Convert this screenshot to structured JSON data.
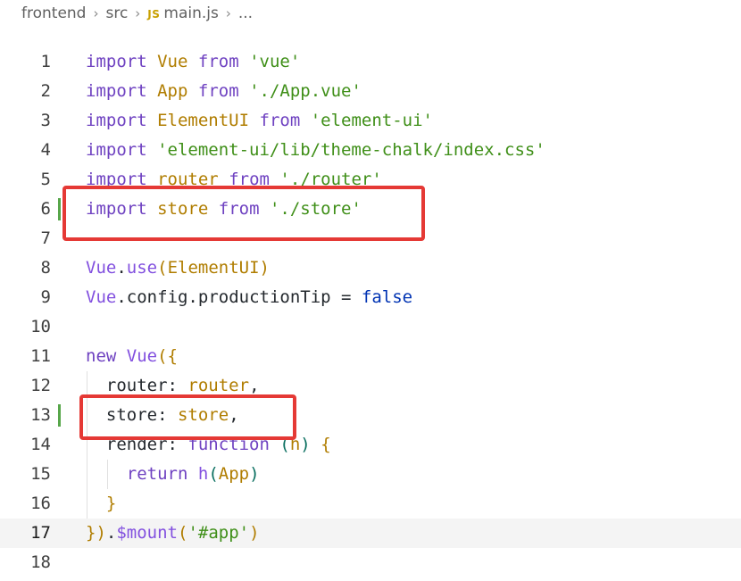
{
  "breadcrumb": {
    "folder1": "frontend",
    "folder2": "src",
    "file_badge": "JS",
    "file": "main.js",
    "more": "..."
  },
  "lines": [
    {
      "n": "1",
      "tokens": [
        [
          "kw",
          "import"
        ],
        [
          "pun",
          " "
        ],
        [
          "id",
          "Vue"
        ],
        [
          "pun",
          " "
        ],
        [
          "kw",
          "from"
        ],
        [
          "pun",
          " "
        ],
        [
          "str",
          "'vue'"
        ]
      ]
    },
    {
      "n": "2",
      "tokens": [
        [
          "kw",
          "import"
        ],
        [
          "pun",
          " "
        ],
        [
          "id",
          "App"
        ],
        [
          "pun",
          " "
        ],
        [
          "kw",
          "from"
        ],
        [
          "pun",
          " "
        ],
        [
          "str",
          "'./App.vue'"
        ]
      ]
    },
    {
      "n": "3",
      "tokens": [
        [
          "kw",
          "import"
        ],
        [
          "pun",
          " "
        ],
        [
          "id",
          "ElementUI"
        ],
        [
          "pun",
          " "
        ],
        [
          "kw",
          "from"
        ],
        [
          "pun",
          " "
        ],
        [
          "str",
          "'element-ui'"
        ]
      ]
    },
    {
      "n": "4",
      "tokens": [
        [
          "kw",
          "import"
        ],
        [
          "pun",
          " "
        ],
        [
          "str",
          "'element-ui/lib/theme-chalk/index.css'"
        ]
      ]
    },
    {
      "n": "5",
      "tokens": [
        [
          "kw",
          "import"
        ],
        [
          "pun",
          " "
        ],
        [
          "id",
          "router"
        ],
        [
          "pun",
          " "
        ],
        [
          "kw",
          "from"
        ],
        [
          "pun",
          " "
        ],
        [
          "str",
          "'./router'"
        ]
      ]
    },
    {
      "n": "6",
      "tokens": [
        [
          "kw",
          "import"
        ],
        [
          "pun",
          " "
        ],
        [
          "id",
          "store"
        ],
        [
          "pun",
          " "
        ],
        [
          "kw",
          "from"
        ],
        [
          "pun",
          " "
        ],
        [
          "str",
          "'./store'"
        ]
      ]
    },
    {
      "n": "7",
      "tokens": []
    },
    {
      "n": "8",
      "tokens": [
        [
          "fn",
          "Vue"
        ],
        [
          "pun",
          "."
        ],
        [
          "fn",
          "use"
        ],
        [
          "brace",
          "("
        ],
        [
          "id",
          "ElementUI"
        ],
        [
          "brace",
          ")"
        ]
      ]
    },
    {
      "n": "9",
      "tokens": [
        [
          "fn",
          "Vue"
        ],
        [
          "pun",
          "."
        ],
        [
          "prop",
          "config"
        ],
        [
          "pun",
          "."
        ],
        [
          "prop",
          "productionTip"
        ],
        [
          "pun",
          " = "
        ],
        [
          "kw2",
          "false"
        ]
      ]
    },
    {
      "n": "10",
      "tokens": []
    },
    {
      "n": "11",
      "tokens": [
        [
          "kw",
          "new"
        ],
        [
          "pun",
          " "
        ],
        [
          "fn",
          "Vue"
        ],
        [
          "brace",
          "({"
        ]
      ]
    },
    {
      "n": "12",
      "tokens": [
        [
          "pun",
          "  "
        ],
        [
          "prop",
          "router"
        ],
        [
          "pun",
          ": "
        ],
        [
          "id",
          "router"
        ],
        [
          "pun",
          ","
        ]
      ]
    },
    {
      "n": "13",
      "tokens": [
        [
          "pun",
          "  "
        ],
        [
          "prop",
          "store"
        ],
        [
          "pun",
          ": "
        ],
        [
          "id",
          "store"
        ],
        [
          "pun",
          ","
        ]
      ]
    },
    {
      "n": "14",
      "tokens": [
        [
          "pun",
          "  "
        ],
        [
          "prop",
          "render"
        ],
        [
          "pun",
          ": "
        ],
        [
          "kw",
          "function"
        ],
        [
          "pun",
          " "
        ],
        [
          "paren",
          "("
        ],
        [
          "id",
          "h"
        ],
        [
          "paren",
          ")"
        ],
        [
          "pun",
          " "
        ],
        [
          "brace",
          "{"
        ]
      ]
    },
    {
      "n": "15",
      "tokens": [
        [
          "pun",
          "    "
        ],
        [
          "kw",
          "return"
        ],
        [
          "pun",
          " "
        ],
        [
          "fn",
          "h"
        ],
        [
          "paren",
          "("
        ],
        [
          "id",
          "App"
        ],
        [
          "paren",
          ")"
        ]
      ]
    },
    {
      "n": "16",
      "tokens": [
        [
          "pun",
          "  "
        ],
        [
          "brace",
          "}"
        ]
      ]
    },
    {
      "n": "17",
      "tokens": [
        [
          "brace",
          "})"
        ],
        [
          "pun",
          "."
        ],
        [
          "fn",
          "$mount"
        ],
        [
          "brace",
          "("
        ],
        [
          "str",
          "'#app'"
        ],
        [
          "brace",
          ")"
        ]
      ]
    },
    {
      "n": "18",
      "tokens": []
    }
  ],
  "current_line": "17",
  "modified_lines": [
    "6",
    "13"
  ],
  "colors": {
    "highlight": "#e53935",
    "modified_gutter": "#57a64a"
  }
}
